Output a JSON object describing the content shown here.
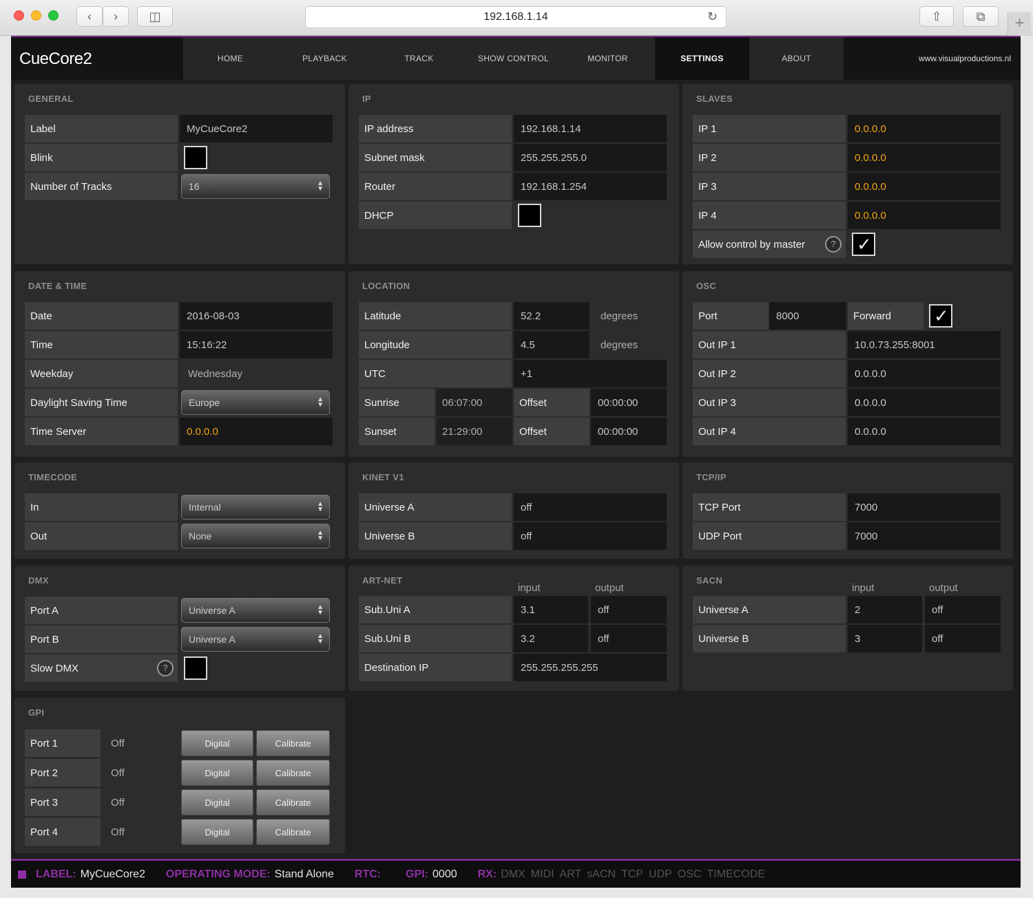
{
  "browser": {
    "url": "192.168.1.14"
  },
  "app": {
    "brand": "CueCore2",
    "nav": [
      "HOME",
      "PLAYBACK",
      "TRACK",
      "SHOW CONTROL",
      "MONITOR",
      "SETTINGS",
      "ABOUT"
    ],
    "active_tab": "SETTINGS",
    "website": "www.visualproductions.nl"
  },
  "general": {
    "title": "GENERAL",
    "label_label": "Label",
    "label_value": "MyCueCore2",
    "blink_label": "Blink",
    "blink_checked": false,
    "tracks_label": "Number of Tracks",
    "tracks_value": "16"
  },
  "ip": {
    "title": "IP",
    "address_label": "IP address",
    "address_value": "192.168.1.14",
    "subnet_label": "Subnet mask",
    "subnet_value": "255.255.255.0",
    "router_label": "Router",
    "router_value": "192.168.1.254",
    "dhcp_label": "DHCP",
    "dhcp_checked": false
  },
  "slaves": {
    "title": "SLAVES",
    "ips": [
      {
        "label": "IP 1",
        "value": "0.0.0.0"
      },
      {
        "label": "IP 2",
        "value": "0.0.0.0"
      },
      {
        "label": "IP 3",
        "value": "0.0.0.0"
      },
      {
        "label": "IP 4",
        "value": "0.0.0.0"
      }
    ],
    "allow_label": "Allow control by master",
    "allow_checked": true
  },
  "datetime": {
    "title": "DATE & TIME",
    "date_label": "Date",
    "date_value": "2016-08-03",
    "time_label": "Time",
    "time_value": "15:16:22",
    "weekday_label": "Weekday",
    "weekday_value": "Wednesday",
    "dst_label": "Daylight Saving Time",
    "dst_value": "Europe",
    "server_label": "Time Server",
    "server_value": "0.0.0.0"
  },
  "location": {
    "title": "LOCATION",
    "lat_label": "Latitude",
    "lat_value": "52.2",
    "lat_unit": "degrees",
    "lon_label": "Longitude",
    "lon_value": "4.5",
    "lon_unit": "degrees",
    "utc_label": "UTC",
    "utc_value": "+1",
    "sunrise_label": "Sunrise",
    "sunrise_value": "06:07:00",
    "sunrise_offset_label": "Offset",
    "sunrise_offset_value": "00:00:00",
    "sunset_label": "Sunset",
    "sunset_value": "21:29:00",
    "sunset_offset_label": "Offset",
    "sunset_offset_value": "00:00:00"
  },
  "osc": {
    "title": "OSC",
    "port_label": "Port",
    "port_value": "8000",
    "forward_label": "Forward",
    "forward_checked": true,
    "outs": [
      {
        "label": "Out IP 1",
        "value": "10.0.73.255:8001"
      },
      {
        "label": "Out IP 2",
        "value": "0.0.0.0"
      },
      {
        "label": "Out IP 3",
        "value": "0.0.0.0"
      },
      {
        "label": "Out IP 4",
        "value": "0.0.0.0"
      }
    ]
  },
  "timecode": {
    "title": "TIMECODE",
    "in_label": "In",
    "in_value": "Internal",
    "out_label": "Out",
    "out_value": "None"
  },
  "kinet": {
    "title": "KINET V1",
    "a_label": "Universe A",
    "a_value": "off",
    "b_label": "Universe B",
    "b_value": "off"
  },
  "tcpip": {
    "title": "TCP/IP",
    "tcp_label": "TCP Port",
    "tcp_value": "7000",
    "udp_label": "UDP Port",
    "udp_value": "7000"
  },
  "dmx": {
    "title": "DMX",
    "a_label": "Port A",
    "a_value": "Universe A",
    "b_label": "Port B",
    "b_value": "Universe A",
    "slow_label": "Slow DMX",
    "slow_checked": false
  },
  "artnet": {
    "title": "ART-NET",
    "input_hdr": "input",
    "output_hdr": "output",
    "a_label": "Sub.Uni A",
    "a_in": "3.1",
    "a_out": "off",
    "b_label": "Sub.Uni B",
    "b_in": "3.2",
    "b_out": "off",
    "dest_label": "Destination IP",
    "dest_value": "255.255.255.255"
  },
  "sacn": {
    "title": "SACN",
    "input_hdr": "input",
    "output_hdr": "output",
    "a_label": "Universe A",
    "a_in": "2",
    "a_out": "off",
    "b_label": "Universe B",
    "b_in": "3",
    "b_out": "off"
  },
  "gpi": {
    "title": "GPI",
    "ports": [
      {
        "label": "Port 1",
        "state": "Off",
        "mode": "Digital",
        "calibrate": "Calibrate"
      },
      {
        "label": "Port 2",
        "state": "Off",
        "mode": "Digital",
        "calibrate": "Calibrate"
      },
      {
        "label": "Port 3",
        "state": "Off",
        "mode": "Digital",
        "calibrate": "Calibrate"
      },
      {
        "label": "Port 4",
        "state": "Off",
        "mode": "Digital",
        "calibrate": "Calibrate"
      }
    ]
  },
  "status": {
    "label_key": "LABEL:",
    "label_value": "MyCueCore2",
    "mode_key": "OPERATING MODE:",
    "mode_value": "Stand Alone",
    "rtc_key": "RTC:",
    "gpi_key": "GPI:",
    "gpi_value": "0000",
    "rx_key": "RX:",
    "rx_items": [
      "DMX",
      "MIDI",
      "ART",
      "sACN",
      "TCP",
      "UDP",
      "OSC",
      "TIMECODE"
    ]
  },
  "colors": {
    "accent": "#8e2fa4",
    "highlight": "#f2a514",
    "panel": "#2c2c2c"
  }
}
